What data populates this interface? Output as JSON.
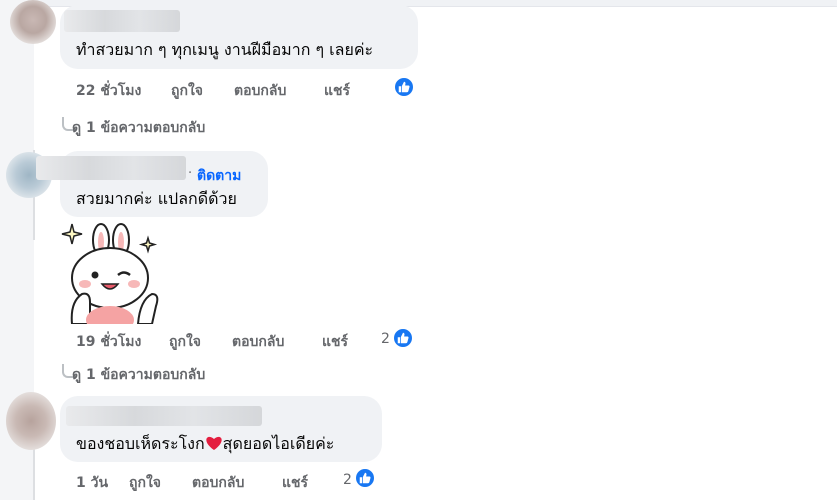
{
  "comments": [
    {
      "text": "ทำสวยมาก ๆ ทุกเมนู งานฝีมือมาก ๆ เลยค่ะ",
      "actions": {
        "time": "22 ชั่วโมง",
        "like": "ถูกใจ",
        "reply": "ตอบกลับ",
        "share": "แชร์"
      },
      "reaction_count": "",
      "view_replies": "ดู 1 ข้อความตอบกลับ"
    },
    {
      "follow": "ติดตาม",
      "text": "สวยมากค่ะ แปลกดีด้วย",
      "sticker": "bunny-thumbs-up-sticker",
      "actions": {
        "time": "19 ชั่วโมง",
        "like": "ถูกใจ",
        "reply": "ตอบกลับ",
        "share": "แชร์"
      },
      "reaction_count": "2",
      "view_replies": "ดู 1 ข้อความตอบกลับ"
    },
    {
      "text_before": "ของชอบเห็ดระโงก",
      "emoji": "heart-emoji",
      "text_after": "สุดยอดไอเดียค่ะ",
      "actions": {
        "time": "1 วัน",
        "like": "ถูกใจ",
        "reply": "ตอบกลับ",
        "share": "แชร์"
      },
      "reaction_count": "2"
    }
  ],
  "colors": {
    "bubble": "#f0f2f5",
    "link": "#0866ff",
    "meta": "#65676b",
    "like_badge": "#1877f2",
    "heart": "#e41e3f"
  },
  "icons": {
    "like": "thumbs-up-icon",
    "reply_arrow": "reply-thread-icon"
  }
}
